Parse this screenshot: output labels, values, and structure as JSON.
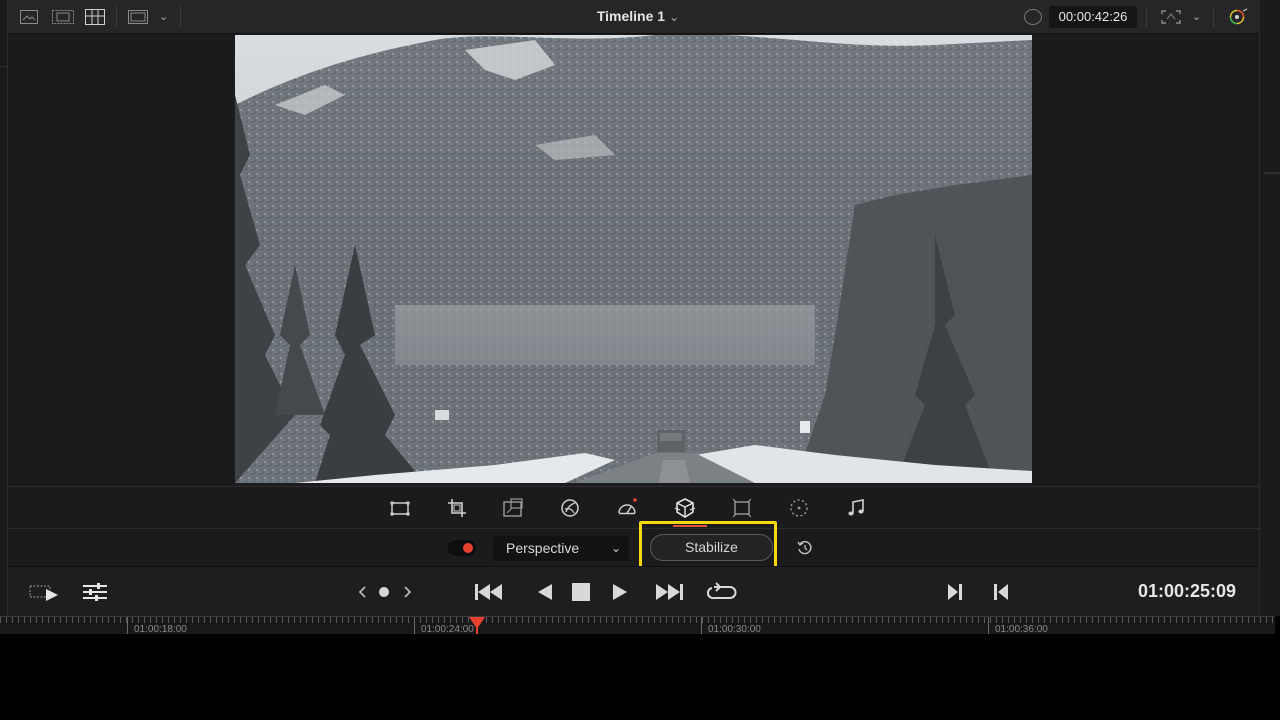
{
  "viewer": {
    "timeline_title": "Timeline 1",
    "source_timecode": "00:00:42:26"
  },
  "video": {
    "scene": "snowy forested mountain road"
  },
  "tools": [
    {
      "name": "transform-tool",
      "icon": "transform-icon"
    },
    {
      "name": "crop-tool",
      "icon": "crop-icon"
    },
    {
      "name": "dynamic-zoom-tool",
      "icon": "dynamic-zoom-icon"
    },
    {
      "name": "open-fx-overlay-tool",
      "icon": "fx-overlay-icon"
    },
    {
      "name": "speed-change-tool",
      "icon": "speedometer-icon"
    },
    {
      "name": "stabilization-tool",
      "icon": "stabilization-icon",
      "active": true
    },
    {
      "name": "annotation-tool",
      "icon": "annotation-icon"
    },
    {
      "name": "smart-reframe-tool",
      "icon": "smart-reframe-icon"
    },
    {
      "name": "audio-tool",
      "icon": "music-note-icon"
    }
  ],
  "stabilization": {
    "mode": "Perspective",
    "stabilize_label": "Stabilize",
    "enabled": true
  },
  "transport": {
    "record_timecode": "01:00:25:09"
  },
  "ruler": {
    "labels": [
      "01:00:18:00",
      "01:00:24:00",
      "01:00:30:00",
      "01:00:36:00"
    ]
  },
  "colors": {
    "accent": "#e5432f",
    "highlight": "#f5d90a",
    "panel": "#1b1b1d"
  }
}
